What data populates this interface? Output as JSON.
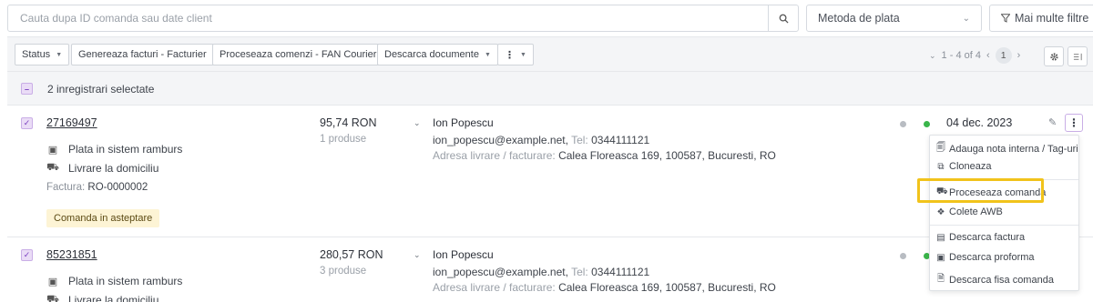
{
  "search": {
    "placeholder": "Cauta dupa ID comanda sau date client",
    "search_icon": "search-icon"
  },
  "payment_filter": {
    "value": "Metoda de plata",
    "icon": "chevron-down-icon"
  },
  "more_filters": {
    "label": "Mai multe filtre",
    "icon": "filter-icon"
  },
  "toolbar": {
    "status_label": "Status",
    "invoices_label": "Genereaza facturi - Facturier",
    "process_label": "Proceseaza comenzi - FAN Courier",
    "download_label": "Descarca documente",
    "more_icon": "kebab-icon",
    "pager": {
      "range": "1 - 4 of 4",
      "page": "1"
    },
    "settings_icon": "gear-icon",
    "columns_icon": "columns-icon"
  },
  "selection": {
    "label": "2 inregistrari selectate"
  },
  "orders": [
    {
      "id": "27169497",
      "payment": "Plata in sistem ramburs",
      "delivery": "Livrare la domiciliu",
      "invoice_label": "Factura:",
      "invoice": "RO-0000002",
      "status": "Comanda in asteptare",
      "total": "95,74 RON",
      "products": "1 produse",
      "customer": "Ion Popescu",
      "email": "ion_popescu@example.net,",
      "phone_label": "Tel:",
      "phone": "0344111121",
      "address_label": "Adresa livrare / facturare:",
      "address": "Calea Floreasca 169, 100587, Bucuresti, RO",
      "date": "04 dec. 2023"
    },
    {
      "id": "85231851",
      "payment": "Plata in sistem ramburs",
      "delivery": "Livrare la domiciliu",
      "total": "280,57 RON",
      "products": "3 produse",
      "customer": "Ion Popescu",
      "email": "ion_popescu@example.net,",
      "phone_label": "Tel:",
      "phone": "0344111121",
      "address_label": "Adresa livrare / facturare:",
      "address": "Calea Floreasca 169, 100587, Bucuresti, RO"
    }
  ],
  "menu": {
    "items": [
      {
        "label": "Adauga nota interna / Tag-uri",
        "icon": "note-icon"
      },
      {
        "label": "Cloneaza",
        "icon": "copy-icon"
      },
      {
        "label": "Proceseaza comanda",
        "icon": "truck-icon"
      },
      {
        "label": "Colete AWB",
        "icon": "package-icon"
      },
      {
        "label": "Descarca factura",
        "icon": "invoice-icon"
      },
      {
        "label": "Descarca proforma",
        "icon": "proforma-icon"
      },
      {
        "label": "Descarca fisa comanda",
        "icon": "document-icon"
      }
    ]
  },
  "colors": {
    "accent": "#7a3fc0",
    "status_green": "#3ab54a",
    "status_grey": "#b8bcc2",
    "highlight": "#f1c31b",
    "badge_bg": "#fdf4d5"
  }
}
